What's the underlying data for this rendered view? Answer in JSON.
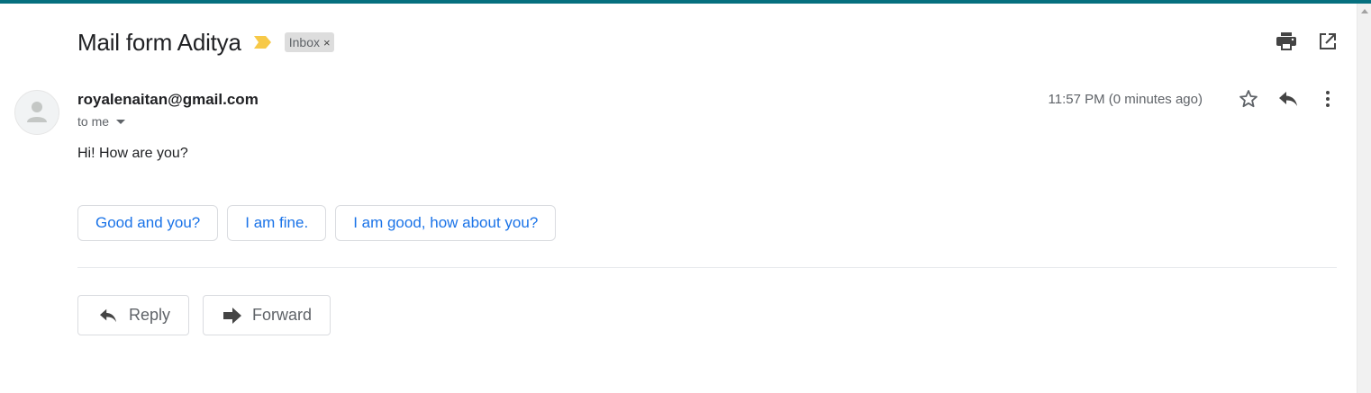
{
  "email": {
    "subject": "Mail form Aditya",
    "label": "Inbox",
    "label_remove": "×",
    "sender": "royalenaitan@gmail.com",
    "recipient": "to me",
    "time": "11:57 PM (0 minutes ago)",
    "body": "Hi! How are you?"
  },
  "header_icons": [
    "print-icon",
    "open-in-new-window-icon"
  ],
  "message_icons": [
    "star-icon",
    "reply-icon",
    "more-vert-icon"
  ],
  "smart_replies": [
    "Good and you?",
    "I am fine.",
    "I am good, how about you?"
  ],
  "actions": {
    "reply": "Reply",
    "forward": "Forward"
  },
  "colors": {
    "accent_bar": "#06707f",
    "importance": "#f7c948",
    "link_blue": "#1a73e8"
  }
}
